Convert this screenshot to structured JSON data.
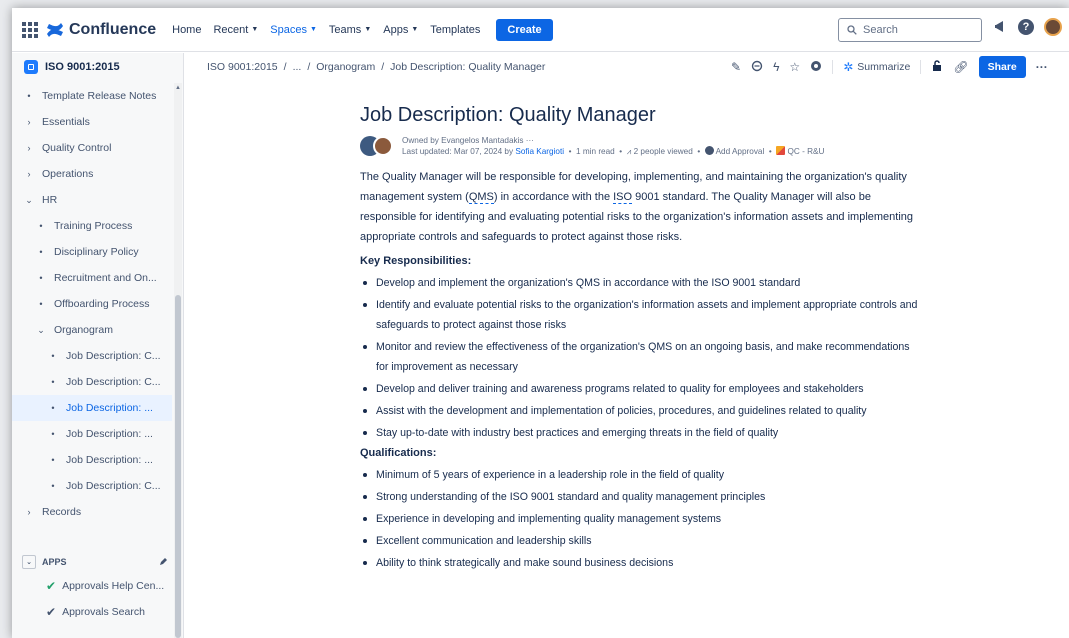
{
  "app": {
    "name": "Confluence"
  },
  "nav": {
    "home": "Home",
    "recent": "Recent",
    "spaces": "Spaces",
    "teams": "Teams",
    "apps": "Apps",
    "templates": "Templates",
    "create": "Create",
    "search_placeholder": "Search"
  },
  "sidebar": {
    "space_name": "ISO 9001:2015",
    "items": [
      {
        "label": "Template Release Notes",
        "marker": "•"
      },
      {
        "label": "Essentials",
        "marker": "›"
      },
      {
        "label": "Quality Control",
        "marker": "›"
      },
      {
        "label": "Operations",
        "marker": "›"
      },
      {
        "label": "HR",
        "marker": "⌄"
      },
      {
        "label": "Training Process",
        "marker": "•"
      },
      {
        "label": "Disciplinary Policy",
        "marker": "•"
      },
      {
        "label": "Recruitment and On...",
        "marker": "•"
      },
      {
        "label": "Offboarding Process",
        "marker": "•"
      },
      {
        "label": "Organogram",
        "marker": "⌄"
      },
      {
        "label": "Job Description: C...",
        "marker": "•"
      },
      {
        "label": "Job Description: C...",
        "marker": "•"
      },
      {
        "label": "Job Description: ...",
        "marker": "•"
      },
      {
        "label": "Job Description: ...",
        "marker": "•"
      },
      {
        "label": "Job Description: ...",
        "marker": "•"
      },
      {
        "label": "Job Description: C...",
        "marker": "•"
      },
      {
        "label": "Records",
        "marker": "›"
      }
    ],
    "apps_header": "APPS",
    "apps": [
      {
        "label": "Approvals Help Cen..."
      },
      {
        "label": "Approvals Search"
      }
    ]
  },
  "breadcrumb": {
    "root": "ISO 9001:2015",
    "sep": "/",
    "ellipsis": "...",
    "parent": "Organogram",
    "current": "Job Description: Quality Manager"
  },
  "toolbar": {
    "summarize": "Summarize",
    "share": "Share"
  },
  "page": {
    "title": "Job Description: Quality Manager",
    "owner_line": "Owned by Evangelos Mantadakis ···",
    "updated_prefix": "Last updated: Mar 07, 2024 by",
    "updated_by": "Sofia Kargioti",
    "read_time": "1 min read",
    "viewed": "2 people viewed",
    "add_approval": "Add Approval",
    "qc_label": "QC - R&U",
    "intro_1": "The Quality Manager will be responsible for developing, implementing, and maintaining the organization's quality management system (",
    "intro_qms": "QMS",
    "intro_2": ") in accordance with the ",
    "intro_iso": "ISO",
    "intro_3": " 9001 standard. The Quality Manager will also be responsible for identifying and evaluating potential risks to the organization's information assets and implementing appropriate controls and safeguards to protect against those risks.",
    "key_heading": "Key Responsibilities:",
    "key_items": [
      "Develop and implement the organization's QMS in accordance with the ISO 9001 standard",
      "Identify and evaluate potential risks to the organization's information assets and implement appropriate controls and safeguards to protect against those risks",
      "Monitor and review the effectiveness of the organization's QMS on an ongoing basis, and make recommendations for improvement as necessary",
      "Develop and deliver training and awareness programs related to quality for employees and stakeholders",
      "Assist with the development and implementation of policies, procedures, and guidelines related to quality",
      "Stay up-to-date with industry best practices and emerging threats in the field of quality"
    ],
    "qual_heading": "Qualifications:",
    "qual_items": [
      "Minimum of 5 years of experience in a leadership role in the field of quality",
      "Strong understanding of the ISO 9001 standard and quality management principles",
      "Experience in developing and implementing quality management systems",
      "Excellent communication and leadership skills",
      "Ability to think strategically and make sound business decisions"
    ]
  },
  "colors": {
    "accent": "#0c66e4",
    "sidebar_bg": "#f7f8f9",
    "selected_bg": "#e9f2ff",
    "approval_check": "#22a06b"
  }
}
